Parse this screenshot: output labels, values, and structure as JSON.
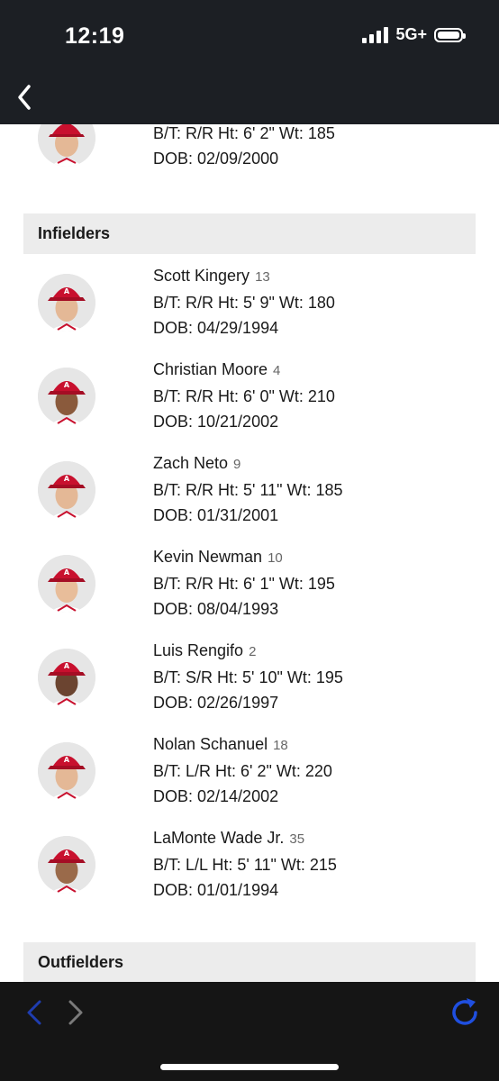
{
  "status_bar": {
    "time": "12:19",
    "network": "5G+"
  },
  "partial_player": {
    "bt_ht_wt": "B/T: R/R  Ht: 6' 2\"  Wt: 185",
    "dob": "DOB: 02/09/2000"
  },
  "sections": {
    "infielders": "Infielders",
    "outfielders": "Outfielders"
  },
  "infielders": [
    {
      "name": "Scott Kingery",
      "number": "13",
      "bt_ht_wt": "B/T: R/R  Ht: 5' 9\"  Wt: 180",
      "dob": "DOB: 04/29/1994"
    },
    {
      "name": "Christian Moore",
      "number": "4",
      "bt_ht_wt": "B/T: R/R  Ht: 6' 0\"  Wt: 210",
      "dob": "DOB: 10/21/2002"
    },
    {
      "name": "Zach Neto",
      "number": "9",
      "bt_ht_wt": "B/T: R/R  Ht: 5' 11\"  Wt: 185",
      "dob": "DOB: 01/31/2001"
    },
    {
      "name": "Kevin Newman",
      "number": "10",
      "bt_ht_wt": "B/T: R/R  Ht: 6' 1\"  Wt: 195",
      "dob": "DOB: 08/04/1993"
    },
    {
      "name": "Luis Rengifo",
      "number": "2",
      "bt_ht_wt": "B/T: S/R  Ht: 5' 10\"  Wt: 195",
      "dob": "DOB: 02/26/1997"
    },
    {
      "name": "Nolan Schanuel",
      "number": "18",
      "bt_ht_wt": "B/T: L/R  Ht: 6' 2\"  Wt: 220",
      "dob": "DOB: 02/14/2002"
    },
    {
      "name": "LaMonte Wade Jr.",
      "number": "35",
      "bt_ht_wt": "B/T: L/L  Ht: 5' 11\"  Wt: 215",
      "dob": "DOB: 01/01/1994"
    }
  ],
  "icons": {
    "back": "chevron-left-icon",
    "browser_back": "arrow-left-icon",
    "browser_forward": "arrow-right-icon",
    "reload": "reload-icon"
  },
  "colors": {
    "header_bg": "#1c1f24",
    "toolbar_bg": "#151515",
    "accent_blue": "#1f4fe0",
    "section_bg": "#ececec",
    "cap_red": "#c8102e"
  }
}
